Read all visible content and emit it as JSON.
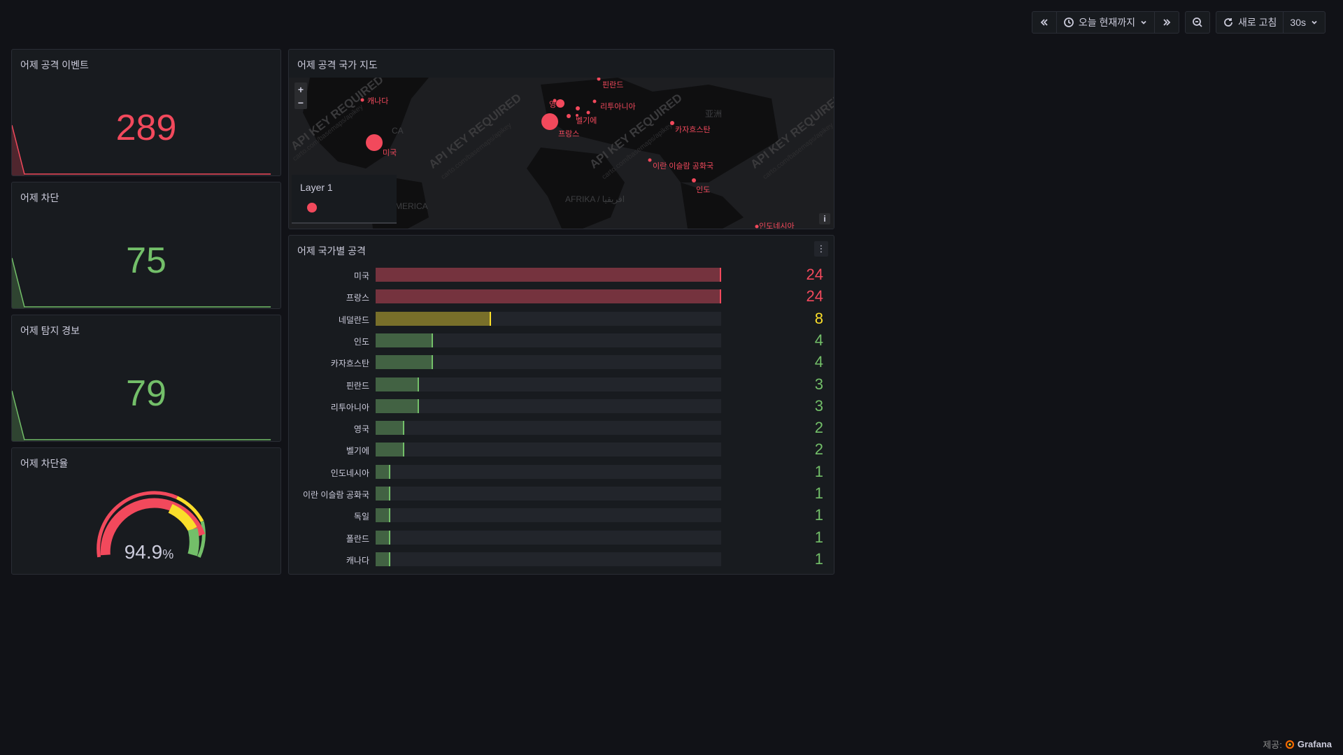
{
  "toolbar": {
    "time_range": "오늘 현재까지",
    "refresh_label": "새로 고침",
    "refresh_interval": "30s"
  },
  "panels": {
    "events": {
      "title": "어제 공격 이벤트",
      "value": "289",
      "color": "#f2495c"
    },
    "blocked": {
      "title": "어제 차단",
      "value": "75",
      "color": "#73bf69"
    },
    "alerts": {
      "title": "어제 탐지 경보",
      "value": "79",
      "color": "#73bf69"
    },
    "block_rate": {
      "title": "어제 차단율",
      "value": "94.9",
      "unit": "%"
    }
  },
  "map": {
    "title": "어제 공격 국가 지도",
    "watermark": "API KEY REQUIRED",
    "watermark_sub": "carto.com/basemaps/apikey",
    "continent_labels": [
      "MERICA",
      "AFRIKA / افريقيا",
      "亚洲",
      "CA"
    ],
    "legend_title": "Layer 1",
    "info_label": "i",
    "markers": [
      {
        "label": "캐나다"
      },
      {
        "label": "미국"
      },
      {
        "label": "핀란드"
      },
      {
        "label": "리투아니아"
      },
      {
        "label": "영"
      },
      {
        "label": "벨기에"
      },
      {
        "label": "프랑스"
      },
      {
        "label": "카자흐스탄"
      },
      {
        "label": "이란 이슬람 공화국"
      },
      {
        "label": "인도"
      },
      {
        "label": "인도네시아"
      }
    ]
  },
  "bars": {
    "title": "어제 국가별 공격",
    "max": 24,
    "rows": [
      {
        "label": "미국",
        "value": 24,
        "color": "#f2495c"
      },
      {
        "label": "프랑스",
        "value": 24,
        "color": "#f2495c"
      },
      {
        "label": "네덜란드",
        "value": 8,
        "color": "#fade2a"
      },
      {
        "label": "인도",
        "value": 4,
        "color": "#73bf69"
      },
      {
        "label": "카자흐스탄",
        "value": 4,
        "color": "#73bf69"
      },
      {
        "label": "핀란드",
        "value": 3,
        "color": "#73bf69"
      },
      {
        "label": "리투아니아",
        "value": 3,
        "color": "#73bf69"
      },
      {
        "label": "영국",
        "value": 2,
        "color": "#73bf69"
      },
      {
        "label": "벨기에",
        "value": 2,
        "color": "#73bf69"
      },
      {
        "label": "인도네시아",
        "value": 1,
        "color": "#73bf69"
      },
      {
        "label": "이란 이슬람 공화국",
        "value": 1,
        "color": "#73bf69"
      },
      {
        "label": "독일",
        "value": 1,
        "color": "#73bf69"
      },
      {
        "label": "폴란드",
        "value": 1,
        "color": "#73bf69"
      },
      {
        "label": "캐나다",
        "value": 1,
        "color": "#73bf69"
      }
    ]
  },
  "footer": {
    "prefix": "제공:",
    "brand": "Grafana"
  }
}
